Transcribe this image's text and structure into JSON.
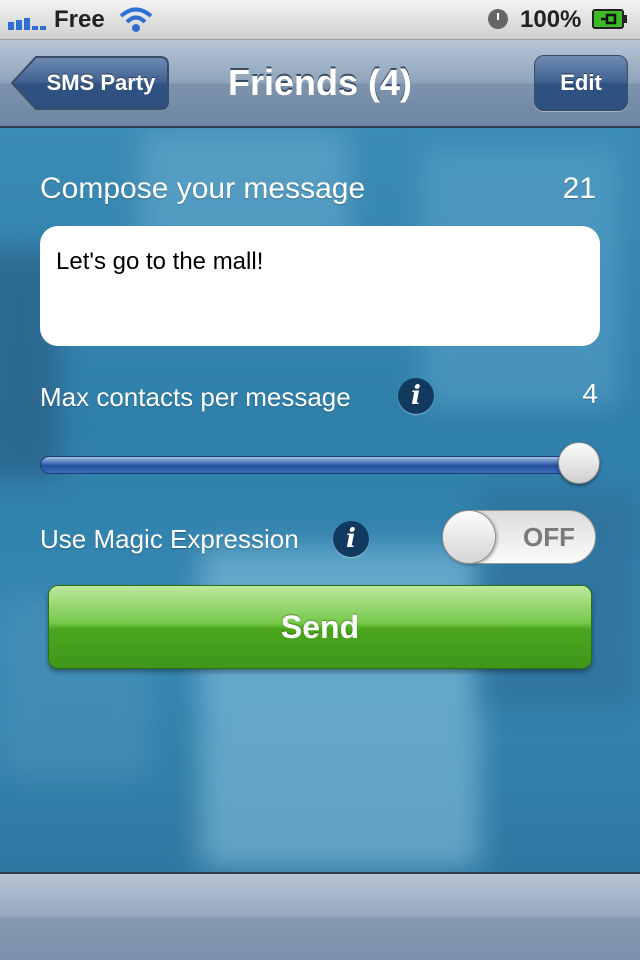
{
  "status_bar": {
    "carrier": "Free",
    "battery_percent": "100%",
    "signal_icon": "signal-bars-icon",
    "wifi_icon": "wifi-icon",
    "clock_icon": "alarm-clock-icon",
    "battery_icon": "battery-charging-icon"
  },
  "nav": {
    "back_label": "SMS Party",
    "title": "Friends (4)",
    "edit_label": "Edit"
  },
  "compose": {
    "heading": "Compose your message",
    "char_count": "21",
    "message": "Let's go to the mall!"
  },
  "max_contacts": {
    "label": "Max contacts per message",
    "value": "4",
    "slider_fraction": 1.0,
    "info_icon": "info-icon"
  },
  "magic_expression": {
    "label": "Use Magic Expression",
    "toggle_text": "OFF",
    "enabled": false,
    "info_icon": "info-icon"
  },
  "send_label": "Send",
  "colors": {
    "nav_bar": "#8ea3ba",
    "edit_button": "#3e5f8e",
    "send_button": "#4aa61c",
    "slider_fill": "#2c5aa8",
    "info_icon_bg": "#123a5e",
    "background": "#2f7ea8"
  }
}
